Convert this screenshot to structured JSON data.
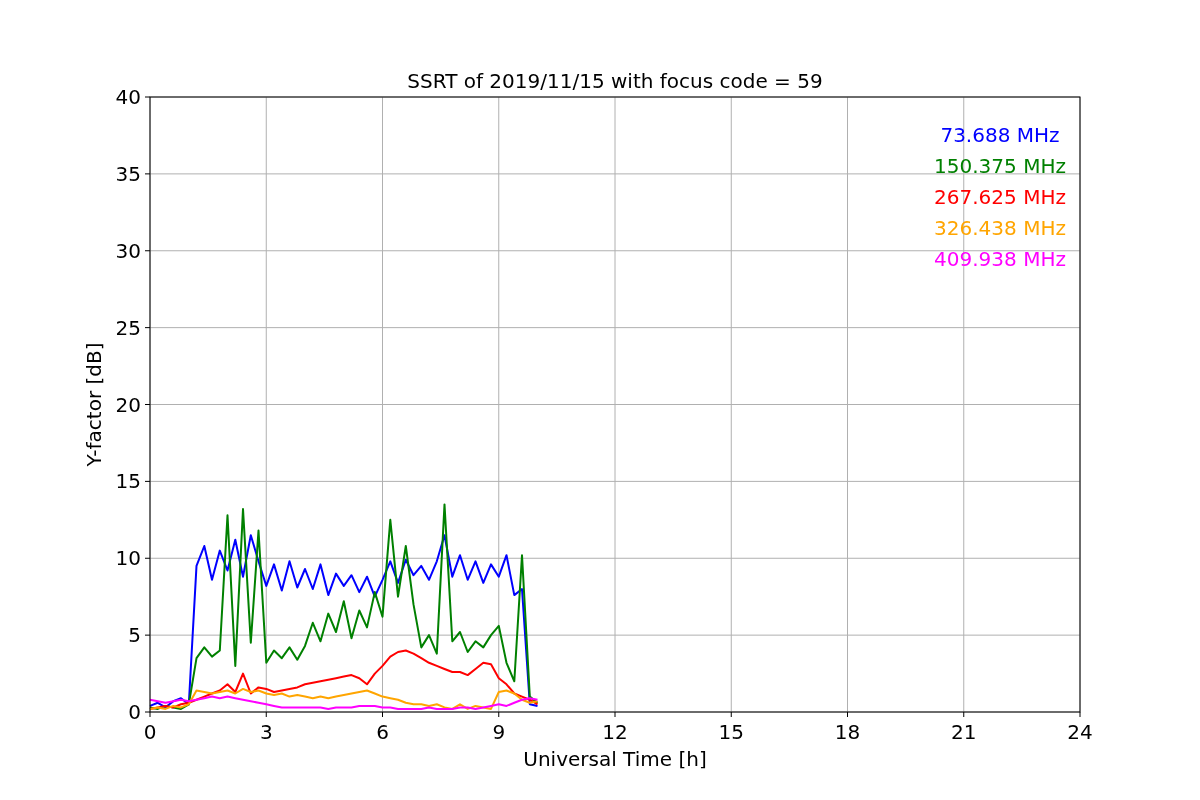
{
  "chart_data": {
    "type": "line",
    "title": "SSRT of 2019/11/15 with focus code = 59",
    "xlabel": "Universal Time [h]",
    "ylabel": "Y-factor [dB]",
    "x": [
      0,
      0.2,
      0.4,
      0.6,
      0.8,
      1.0,
      1.2,
      1.4,
      1.6,
      1.8,
      2.0,
      2.2,
      2.4,
      2.6,
      2.8,
      3.0,
      3.2,
      3.4,
      3.6,
      3.8,
      4.0,
      4.2,
      4.4,
      4.6,
      4.8,
      5.0,
      5.2,
      5.4,
      5.6,
      5.8,
      6.0,
      6.2,
      6.4,
      6.6,
      6.8,
      7.0,
      7.2,
      7.4,
      7.6,
      7.8,
      8.0,
      8.2,
      8.4,
      8.6,
      8.8,
      9.0,
      9.2,
      9.4,
      9.6,
      9.8,
      10.0
    ],
    "series": [
      {
        "name": "73.688 MHz",
        "color": "#0000ff",
        "values": [
          0.4,
          0.6,
          0.3,
          0.7,
          0.9,
          0.5,
          9.5,
          10.8,
          8.6,
          10.5,
          9.2,
          11.2,
          8.8,
          11.5,
          9.8,
          8.2,
          9.6,
          7.9,
          9.8,
          8.1,
          9.3,
          8.0,
          9.6,
          7.6,
          9.0,
          8.2,
          8.9,
          7.8,
          8.8,
          7.5,
          8.6,
          9.8,
          8.4,
          9.9,
          8.9,
          9.5,
          8.6,
          9.8,
          11.5,
          8.8,
          10.2,
          8.6,
          9.8,
          8.4,
          9.6,
          8.8,
          10.2,
          7.6,
          8.0,
          0.5,
          0.4
        ]
      },
      {
        "name": "150.375 MHz",
        "color": "#008000",
        "values": [
          0.3,
          0.2,
          0.4,
          0.3,
          0.2,
          0.5,
          3.5,
          4.2,
          3.6,
          4.0,
          12.8,
          3.0,
          13.2,
          4.5,
          11.8,
          3.2,
          4.0,
          3.5,
          4.2,
          3.4,
          4.3,
          5.8,
          4.6,
          6.4,
          5.2,
          7.2,
          4.8,
          6.6,
          5.5,
          7.8,
          6.2,
          12.5,
          7.5,
          10.8,
          7.0,
          4.2,
          5.0,
          3.8,
          13.5,
          4.6,
          5.2,
          3.9,
          4.6,
          4.2,
          5.0,
          5.6,
          3.2,
          2.0,
          10.2,
          1.0,
          0.6
        ]
      },
      {
        "name": "267.625 MHz",
        "color": "#ff0000",
        "values": [
          0.2,
          0.3,
          0.4,
          0.3,
          0.5,
          0.6,
          0.8,
          1.0,
          1.2,
          1.4,
          1.8,
          1.3,
          2.5,
          1.2,
          1.6,
          1.5,
          1.3,
          1.4,
          1.5,
          1.6,
          1.8,
          1.9,
          2.0,
          2.1,
          2.2,
          2.3,
          2.4,
          2.2,
          1.8,
          2.5,
          3.0,
          3.6,
          3.9,
          4.0,
          3.8,
          3.5,
          3.2,
          3.0,
          2.8,
          2.6,
          2.6,
          2.4,
          2.8,
          3.2,
          3.1,
          2.2,
          1.8,
          1.2,
          1.0,
          0.8,
          0.5
        ]
      },
      {
        "name": "326.438 MHz",
        "color": "#ffa500",
        "values": [
          0.2,
          0.3,
          0.2,
          0.4,
          0.3,
          0.5,
          1.4,
          1.3,
          1.2,
          1.3,
          1.4,
          1.2,
          1.5,
          1.3,
          1.4,
          1.2,
          1.1,
          1.2,
          1.0,
          1.1,
          1.0,
          0.9,
          1.0,
          0.9,
          1.0,
          1.1,
          1.2,
          1.3,
          1.4,
          1.2,
          1.0,
          0.9,
          0.8,
          0.6,
          0.5,
          0.5,
          0.4,
          0.5,
          0.3,
          0.2,
          0.5,
          0.2,
          0.4,
          0.3,
          0.2,
          1.3,
          1.4,
          1.2,
          0.8,
          0.6,
          0.7
        ]
      },
      {
        "name": "409.938 MHz",
        "color": "#ff00ff",
        "values": [
          0.8,
          0.7,
          0.6,
          0.7,
          0.8,
          0.7,
          0.8,
          0.9,
          1.0,
          0.9,
          1.0,
          0.9,
          0.8,
          0.7,
          0.6,
          0.5,
          0.4,
          0.3,
          0.3,
          0.3,
          0.3,
          0.3,
          0.3,
          0.2,
          0.3,
          0.3,
          0.3,
          0.4,
          0.4,
          0.4,
          0.3,
          0.3,
          0.2,
          0.2,
          0.2,
          0.2,
          0.3,
          0.2,
          0.2,
          0.2,
          0.3,
          0.3,
          0.2,
          0.3,
          0.4,
          0.5,
          0.4,
          0.6,
          0.8,
          0.9,
          0.8
        ]
      }
    ],
    "xlim": [
      0,
      24
    ],
    "ylim": [
      0,
      40
    ],
    "xticks": [
      0,
      3,
      6,
      9,
      12,
      15,
      18,
      21,
      24
    ],
    "yticks": [
      0,
      5,
      10,
      15,
      20,
      25,
      30,
      35,
      40
    ],
    "grid": true
  }
}
